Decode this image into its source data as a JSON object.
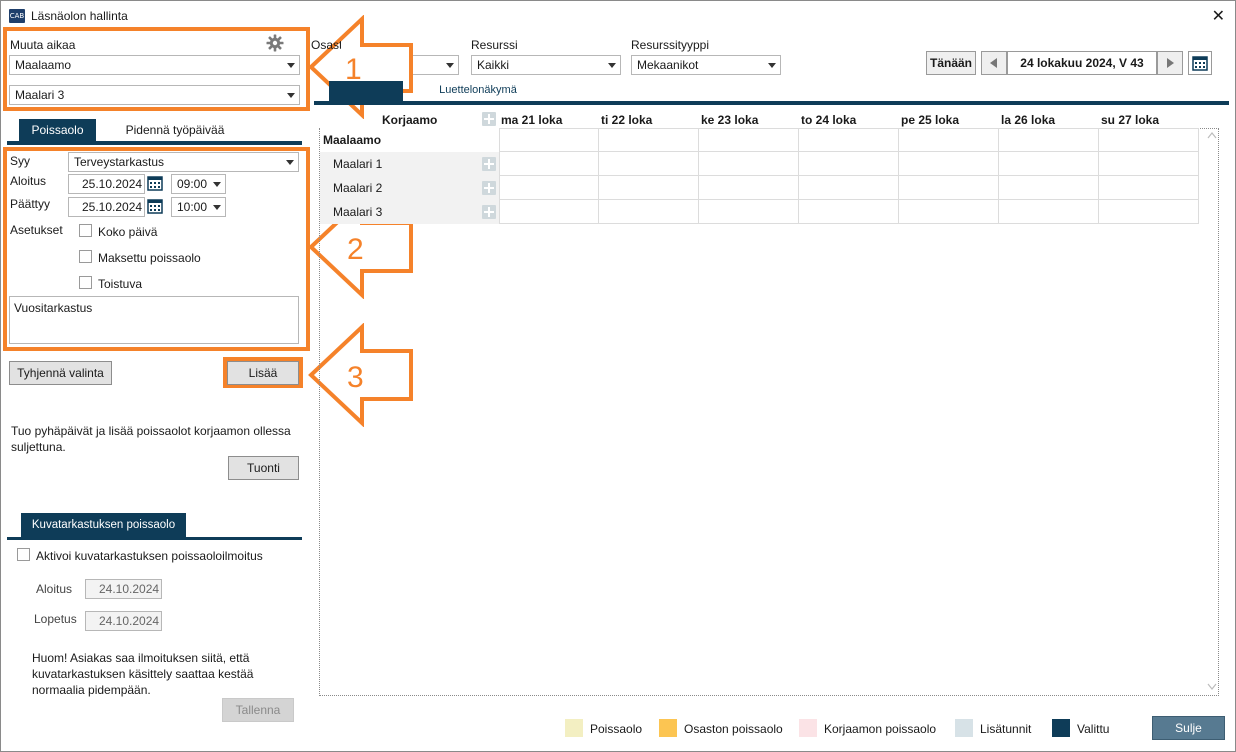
{
  "window": {
    "title": "Läsnäolon hallinta",
    "app_icon": "C-A-B"
  },
  "left": {
    "change_time_label": "Muuta aikaa",
    "workshop_select": "Maalaamo",
    "resource_select": "Maalari 3",
    "tabs": [
      {
        "label": "Poissaolo",
        "active": true
      },
      {
        "label": "Pidennä työpäivää",
        "active": false
      }
    ],
    "form": {
      "reason_label": "Syy",
      "reason_value": "Terveystarkastus",
      "start_label": "Aloitus",
      "start_date": "25.10.2024",
      "start_time": "09:00",
      "end_label": "Päättyy",
      "end_date": "25.10.2024",
      "end_time": "10:00",
      "settings_label": "Asetukset",
      "options": [
        "Koko päivä",
        "Maksettu poissaolo",
        "Toistuva"
      ],
      "notes": "Vuositarkastus"
    },
    "clear_button": "Tyhjennä valinta",
    "add_button": "Lisää",
    "import_text": "Tuo pyhäpäivät ja lisää poissaolot korjaamon ollessa suljettuna.",
    "import_button": "Tuonti",
    "inspection": {
      "tab_label": "Kuvatarkastuksen poissaolo",
      "activate_label": "Aktivoi kuvatarkastuksen poissaoloilmoitus",
      "start_label": "Aloitus",
      "start_value": "24.10.2024",
      "end_label": "Lopetus",
      "end_value": "24.10.2024",
      "note": "Huom! Asiakas saa ilmoituksen siitä, että kuvatarkastuksen käsittely saattaa kestää normaalia pidempään.",
      "save_button": "Tallenna"
    }
  },
  "callouts": {
    "one": "1",
    "two": "2",
    "three": "3"
  },
  "top": {
    "department_label": "Osasto",
    "resource_label": "Resurssi",
    "resource_value": "Kaikki",
    "resource_type_label": "Resurssityyppi",
    "resource_type_value": "Mekaanikot",
    "today_button": "Tänään",
    "date_display": "24 lokakuu 2024, V 43",
    "view_tabs": [
      {
        "label": "",
        "active": true
      },
      {
        "label": "Luettelonäkymä",
        "active": false
      }
    ]
  },
  "grid": {
    "corner_label": "Korjaamo",
    "days": [
      "ma 21 loka",
      "ti 22 loka",
      "ke 23 loka",
      "to 24 loka",
      "pe 25 loka",
      "la 26 loka",
      "su 27 loka"
    ],
    "rows": [
      {
        "label": "Maalaamo",
        "bold": true
      },
      {
        "label": "Maalari 1",
        "bold": false
      },
      {
        "label": "Maalari 2",
        "bold": false
      },
      {
        "label": "Maalari 3",
        "bold": false
      }
    ]
  },
  "legend": [
    {
      "label": "Poissaolo",
      "color": "#f3efc2"
    },
    {
      "label": "Osaston poissaolo",
      "color": "#fcc552"
    },
    {
      "label": "Korjaamon poissaolo",
      "color": "#fbe3e6"
    },
    {
      "label": "Lisätunnit",
      "color": "#d7e2e7"
    },
    {
      "label": "Valittu",
      "color": "#0e3c58"
    }
  ],
  "close_button": "Sulje",
  "colors": {
    "accent": "#0e3c58",
    "callout": "#f5822a"
  }
}
